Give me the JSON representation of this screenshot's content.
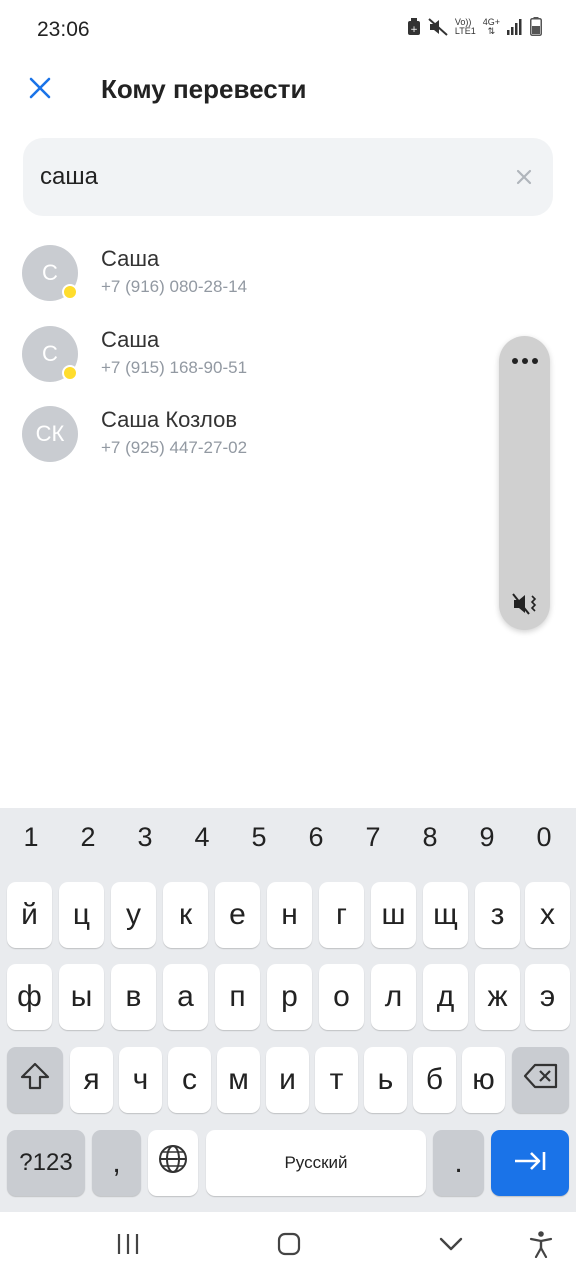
{
  "status_bar": {
    "time": "23:06",
    "icons": [
      "data-saver-icon",
      "mute-icon",
      "volte-icon",
      "network-4g-icon",
      "signal-icon",
      "battery-icon"
    ],
    "volte_top": "Vo))",
    "volte_bottom": "LTE1",
    "network_label": "4G+"
  },
  "header": {
    "title": "Кому перевести",
    "close_icon": "close-icon",
    "accent_color": "#1a73e8"
  },
  "search": {
    "value": "саша",
    "placeholder": "",
    "clear_icon": "clear-icon"
  },
  "contacts": [
    {
      "initials": "С",
      "name": "Саша",
      "phone": "+7 (916) 080-28-14",
      "badge_color": "#ffdd2d"
    },
    {
      "initials": "С",
      "name": "Саша",
      "phone": "+7 (915) 168-90-51",
      "badge_color": "#ffdd2d"
    },
    {
      "initials": "СК",
      "name": "Саша Козлов",
      "phone": "+7 (925) 447-27-02"
    }
  ],
  "volume_panel": {
    "icons": [
      "more-icon",
      "vibrate-mute-icon"
    ]
  },
  "keyboard": {
    "numbers": [
      "1",
      "2",
      "3",
      "4",
      "5",
      "6",
      "7",
      "8",
      "9",
      "0"
    ],
    "row1": [
      "й",
      "ц",
      "у",
      "к",
      "е",
      "н",
      "г",
      "ш",
      "щ",
      "з",
      "х"
    ],
    "row2": [
      "ф",
      "ы",
      "в",
      "а",
      "п",
      "р",
      "о",
      "л",
      "д",
      "ж",
      "э"
    ],
    "row3": [
      "я",
      "ч",
      "с",
      "м",
      "и",
      "т",
      "ь",
      "б",
      "ю"
    ],
    "symbols_label": "?123",
    "comma": ",",
    "space_label": "Русский",
    "period": ".",
    "shift_icon": "shift-icon",
    "backspace_icon": "backspace-icon",
    "globe_icon": "globe-icon",
    "enter_icon": "next-arrow-icon"
  },
  "nav_bar": {
    "icons": [
      "recent-apps-icon",
      "home-icon",
      "back-icon",
      "accessibility-icon"
    ]
  }
}
